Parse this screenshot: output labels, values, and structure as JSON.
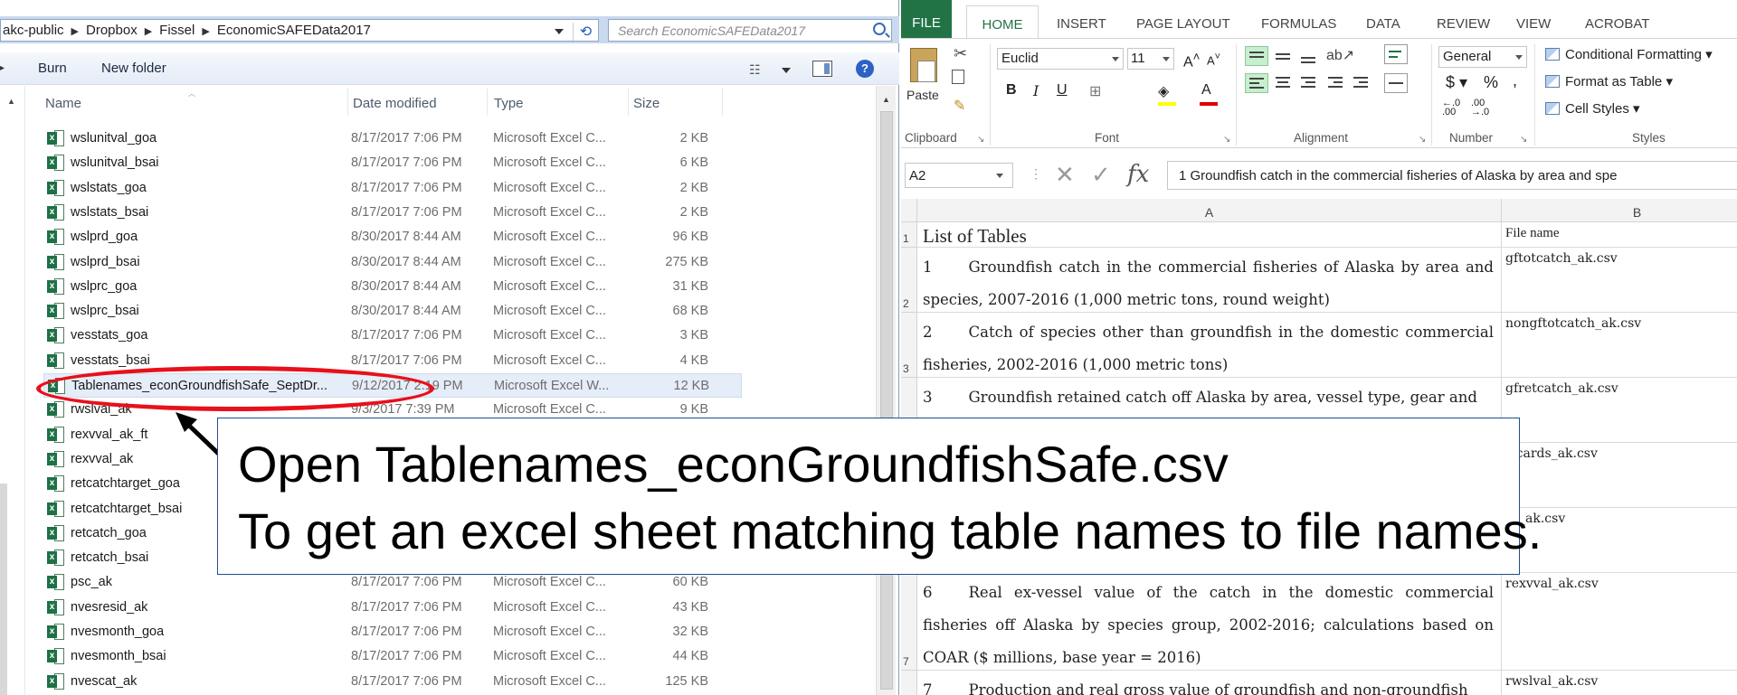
{
  "explorer": {
    "breadcrumbs": [
      "akc-public",
      "Dropbox",
      "Fissel",
      "EconomicSAFEData2017"
    ],
    "search_placeholder": "Search EconomicSAFEData2017",
    "toolbar": {
      "burn": "Burn",
      "new_folder": "New folder"
    },
    "columns": {
      "name": "Name",
      "date": "Date modified",
      "type": "Type",
      "size": "Size"
    },
    "files": [
      {
        "name": "wslunitval_goa",
        "date": "8/17/2017 7:06 PM",
        "type": "Microsoft Excel C...",
        "size": "2 KB"
      },
      {
        "name": "wslunitval_bsai",
        "date": "8/17/2017 7:06 PM",
        "type": "Microsoft Excel C...",
        "size": "6 KB"
      },
      {
        "name": "wslstats_goa",
        "date": "8/17/2017 7:06 PM",
        "type": "Microsoft Excel C...",
        "size": "2 KB"
      },
      {
        "name": "wslstats_bsai",
        "date": "8/17/2017 7:06 PM",
        "type": "Microsoft Excel C...",
        "size": "2 KB"
      },
      {
        "name": "wslprd_goa",
        "date": "8/30/2017 8:44 AM",
        "type": "Microsoft Excel C...",
        "size": "96 KB"
      },
      {
        "name": "wslprd_bsai",
        "date": "8/30/2017 8:44 AM",
        "type": "Microsoft Excel C...",
        "size": "275 KB"
      },
      {
        "name": "wslprc_goa",
        "date": "8/30/2017 8:44 AM",
        "type": "Microsoft Excel C...",
        "size": "31 KB"
      },
      {
        "name": "wslprc_bsai",
        "date": "8/30/2017 8:44 AM",
        "type": "Microsoft Excel C...",
        "size": "68 KB"
      },
      {
        "name": "vesstats_goa",
        "date": "8/17/2017 7:06 PM",
        "type": "Microsoft Excel C...",
        "size": "3 KB"
      },
      {
        "name": "vesstats_bsai",
        "date": "8/17/2017 7:06 PM",
        "type": "Microsoft Excel C...",
        "size": "4 KB"
      },
      {
        "name": "Tablenames_econGroundfishSafe_SeptDr...",
        "date": "9/12/2017 2:19 PM",
        "type": "Microsoft Excel W...",
        "size": "12 KB",
        "selected": true
      },
      {
        "name": "rwslval_ak",
        "date": "9/3/2017 7:39 PM",
        "type": "Microsoft Excel C...",
        "size": "9 KB"
      },
      {
        "name": "rexvval_ak_ft",
        "date": "",
        "type": "",
        "size": ""
      },
      {
        "name": "rexvval_ak",
        "date": "",
        "type": "",
        "size": ""
      },
      {
        "name": "retcatchtarget_goa",
        "date": "",
        "type": "",
        "size": ""
      },
      {
        "name": "retcatchtarget_bsai",
        "date": "",
        "type": "",
        "size": ""
      },
      {
        "name": "retcatch_goa",
        "date": "",
        "type": "",
        "size": ""
      },
      {
        "name": "retcatch_bsai",
        "date": "",
        "type": "",
        "size": ""
      },
      {
        "name": "psc_ak",
        "date": "8/17/2017 7:06 PM",
        "type": "Microsoft Excel C...",
        "size": "60 KB"
      },
      {
        "name": "nvesresid_ak",
        "date": "8/17/2017 7:06 PM",
        "type": "Microsoft Excel C...",
        "size": "43 KB"
      },
      {
        "name": "nvesmonth_goa",
        "date": "8/17/2017 7:06 PM",
        "type": "Microsoft Excel C...",
        "size": "32 KB"
      },
      {
        "name": "nvesmonth_bsai",
        "date": "8/17/2017 7:06 PM",
        "type": "Microsoft Excel C...",
        "size": "44 KB"
      },
      {
        "name": "nvescat_ak",
        "date": "8/17/2017 7:06 PM",
        "type": "Microsoft Excel C...",
        "size": "125 KB"
      }
    ]
  },
  "excel": {
    "tabs": [
      "FILE",
      "HOME",
      "INSERT",
      "PAGE LAYOUT",
      "FORMULAS",
      "DATA",
      "REVIEW",
      "VIEW",
      "ACROBAT"
    ],
    "ribbon": {
      "paste": "Paste",
      "font_name": "Euclid",
      "font_size": "11",
      "number_format": "General",
      "conditional_formatting": "Conditional Formatting",
      "format_as_table": "Format as Table",
      "cell_styles": "Cell Styles",
      "groups": {
        "clipboard": "Clipboard",
        "font": "Font",
        "alignment": "Alignment",
        "number": "Number",
        "styles": "Styles"
      }
    },
    "name_box": "A2",
    "formula": "1    Groundfish catch in the commercial fisheries of Alaska by area and spe",
    "columns": [
      "A",
      "B"
    ],
    "rows": [
      {
        "num": "1",
        "a_num": "",
        "a": "List of Tables",
        "b": "File name"
      },
      {
        "num": "2",
        "a_num": "1",
        "a": "Groundfish catch in the commercial fisheries of Alaska by area and species, 2007-2016 (1,000 metric tons, round weight)",
        "b": "gftotcatch_ak.csv"
      },
      {
        "num": "3",
        "a_num": "2",
        "a": "Catch of species other than groundfish in the domestic commercial fisheries, 2002-2016 (1,000 metric tons)",
        "b": "nongftotcatch_ak.csv"
      },
      {
        "num": "",
        "a_num": "3",
        "a": "Groundfish retained catch off Alaska by area, vessel type, gear and",
        "b": "gfretcatch_ak.csv"
      },
      {
        "num": "",
        "a_num": "",
        "a": "",
        "b": "iscards_ak.csv"
      },
      {
        "num": "",
        "a_num": "",
        "a": "",
        "b": "sc_ak.csv"
      },
      {
        "num": "7",
        "a_num": "6",
        "a": "Real ex-vessel value of the catch in the domestic commercial fisheries off Alaska by species group, 2002-2016; calculations based on COAR ($ millions, base year = 2016)",
        "b": "rexvval_ak.csv"
      },
      {
        "num": "",
        "a_num": "7",
        "a": "Production and real gross value of groundfish and non-groundfish",
        "b": "rwslval_ak.csv"
      }
    ]
  },
  "callout": {
    "line1": "Open Tablenames_econGroundfishSafe.csv",
    "line2": "To get an excel sheet matching table names to file names."
  }
}
